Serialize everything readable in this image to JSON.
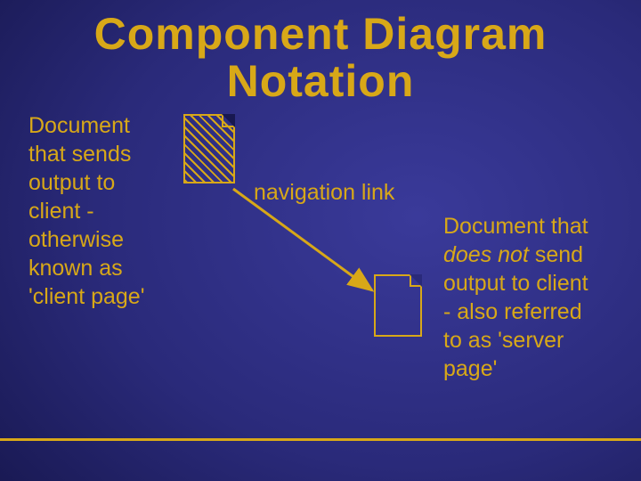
{
  "title_line1": "Component Diagram",
  "title_line2": "Notation",
  "left_caption": {
    "l1": "Document",
    "l2": "that sends",
    "l3": "output to",
    "l4": "client -",
    "l5": "otherwise",
    "l6": "known as",
    "l7": "'client page'"
  },
  "right_caption": {
    "l1": "Document that ",
    "em": "does not",
    "l2_rest": " send",
    "l3": "output to client",
    "l4": "- also referred",
    "l5": "to as 'server",
    "l6": "page'"
  },
  "link_label": "navigation link",
  "colors": {
    "accent": "#d8a818"
  }
}
